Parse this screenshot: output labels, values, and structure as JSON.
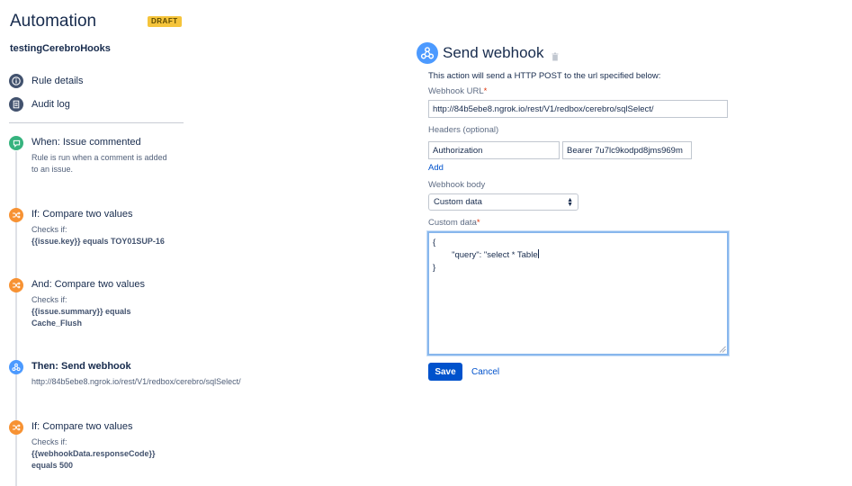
{
  "app": {
    "title": "Automation",
    "status_badge": "DRAFT",
    "rule_name": "testingCerebroHooks"
  },
  "nav": {
    "rule_details": "Rule details",
    "audit_log": "Audit log"
  },
  "steps": [
    {
      "icon": "comment-icon",
      "color": "#36b37e",
      "title": "When: Issue commented",
      "desc_lines": [
        "Rule is run when a comment is added",
        "to an issue."
      ]
    },
    {
      "icon": "shuffle-icon",
      "color": "#f79233",
      "title": "If: Compare two values",
      "desc_lines": [
        "Checks if:",
        "{{issue.key}} equals TOY01SUP-16"
      ]
    },
    {
      "icon": "shuffle-icon",
      "color": "#f79233",
      "title": "And: Compare two values",
      "desc_lines": [
        "Checks if:",
        "{{issue.summary}} equals",
        "Cache_Flush"
      ]
    },
    {
      "icon": "webhook-icon",
      "color": "#4c9aff",
      "title": "Then: Send webhook",
      "desc_lines": [
        "http://84b5ebe8.ngrok.io/rest/V1/redbox/cerebro/sqlSelect/"
      ]
    },
    {
      "icon": "shuffle-icon",
      "color": "#f79233",
      "title": "If: Compare two values",
      "desc_lines": [
        "Checks if:",
        "{{webhookData.responseCode}}",
        "equals 500"
      ]
    }
  ],
  "panel": {
    "title": "Send webhook",
    "intro": "This action will send a HTTP POST to the url specified below:",
    "url_label": "Webhook URL",
    "required_mark": "*",
    "url_value": "http://84b5ebe8.ngrok.io/rest/V1/redbox/cerebro/sqlSelect/",
    "headers_label": "Headers (optional)",
    "header_key": "Authorization",
    "header_value": "Bearer 7u7lc9kodpd8jms969m",
    "add_link": "Add",
    "body_label": "Webhook body",
    "body_selected": "Custom data",
    "custom_label": "Custom data",
    "custom_lines": [
      "{",
      "        \"query\": \"select * Table",
      "}"
    ],
    "save": "Save",
    "cancel": "Cancel"
  },
  "colors": {
    "accent": "#0052cc",
    "condition": "#f79233",
    "trigger": "#36b37e",
    "action": "#4c9aff",
    "draft": "#f5c43b"
  }
}
